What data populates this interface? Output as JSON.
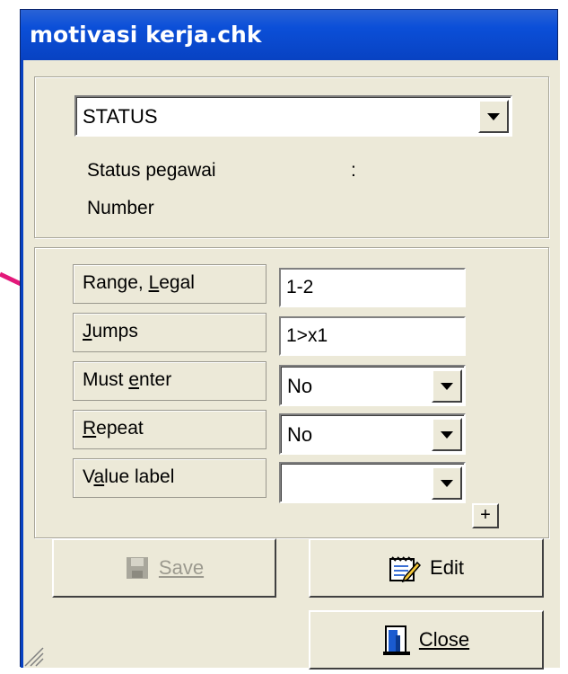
{
  "window": {
    "title": "motivasi kerja.chk"
  },
  "field_select": {
    "value": "STATUS"
  },
  "field_info": {
    "description": "Status pegawai",
    "separator": ":",
    "type": "Number"
  },
  "properties": [
    {
      "label": "Range, Legal",
      "value": "1-2",
      "kind": "text"
    },
    {
      "label": "Jumps",
      "value": "1>x1",
      "kind": "text"
    },
    {
      "label": "Must enter",
      "value": "No",
      "kind": "dropdown"
    },
    {
      "label": "Repeat",
      "value": "No",
      "kind": "dropdown"
    },
    {
      "label": "Value label",
      "value": "",
      "kind": "dropdown"
    }
  ],
  "buttons": {
    "add": "+",
    "save": "Save",
    "edit": "Edit",
    "close": "Close"
  },
  "colors": {
    "title_bar": "#0842c2",
    "annotation_arrow": "#e3187a"
  }
}
